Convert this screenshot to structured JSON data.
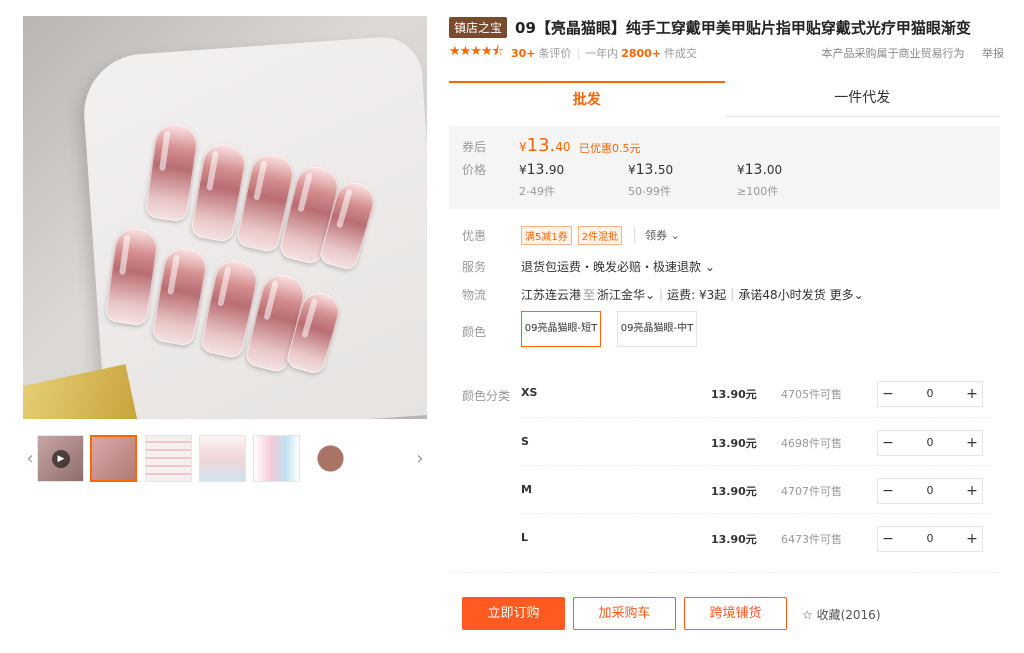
{
  "product": {
    "badge": "镇店之宝",
    "title": "09【亮晶猫眼】纯手工穿戴甲美甲贴片指甲贴穿戴式光疗甲猫眼渐变"
  },
  "rating": {
    "stars": "★★★★⯪",
    "review_count": "30+",
    "review_label": "条评价",
    "sales_period": "一年内",
    "sales_count": "2800+",
    "sales_label": "件成交",
    "note": "本产品采购属于商业贸易行为",
    "report": "举报"
  },
  "tabs": [
    {
      "label": "批发"
    },
    {
      "label": "一件代发"
    }
  ],
  "price": {
    "coupon_label_1": "券后",
    "coupon_label_2": "价格",
    "coupon_currency": "¥",
    "coupon_int": "13.",
    "coupon_dec": "40",
    "coupon_note": "已优惠0.5元",
    "tiers": [
      {
        "cur": "¥",
        "int": "13.",
        "dec": "90",
        "range": "2-49件"
      },
      {
        "cur": "¥",
        "int": "13.",
        "dec": "50",
        "range": "50-99件"
      },
      {
        "cur": "¥",
        "int": "13.",
        "dec": "00",
        "range": "≥100件"
      }
    ]
  },
  "promo": {
    "label": "优惠",
    "tags": [
      "满5减1券",
      "2件混批"
    ],
    "get_coupon": "领券 ⌄"
  },
  "service": {
    "label": "服务",
    "text": "退货包运费・晚发必赔・极速退款 ⌄"
  },
  "logistics": {
    "label": "物流",
    "from": "江苏连云港",
    "to_word": "至",
    "to": "浙江金华⌄",
    "fee": "运费: ¥3起",
    "promise": "承诺48小时发货",
    "more": "更多⌄"
  },
  "color": {
    "label": "颜色",
    "options": [
      "09亮晶猫眼-短T",
      "09亮晶猫眼-中T"
    ]
  },
  "sku": {
    "label": "颜色分类",
    "rows": [
      {
        "name": "XS",
        "price": "13.90元",
        "stock": "4705件可售",
        "qty": "0"
      },
      {
        "name": "S",
        "price": "13.90元",
        "stock": "4698件可售",
        "qty": "0"
      },
      {
        "name": "M",
        "price": "13.90元",
        "stock": "4707件可售",
        "qty": "0"
      },
      {
        "name": "L",
        "price": "13.90元",
        "stock": "6473件可售",
        "qty": "0"
      }
    ],
    "minus": "−",
    "plus": "+"
  },
  "actions": {
    "buy": "立即订购",
    "cart": "加采购车",
    "crossborder": "跨境铺货",
    "favorite_icon": "☆",
    "favorite": "收藏(2016)"
  },
  "gallery": {
    "prev": "‹",
    "next": "›",
    "play": "▶"
  }
}
